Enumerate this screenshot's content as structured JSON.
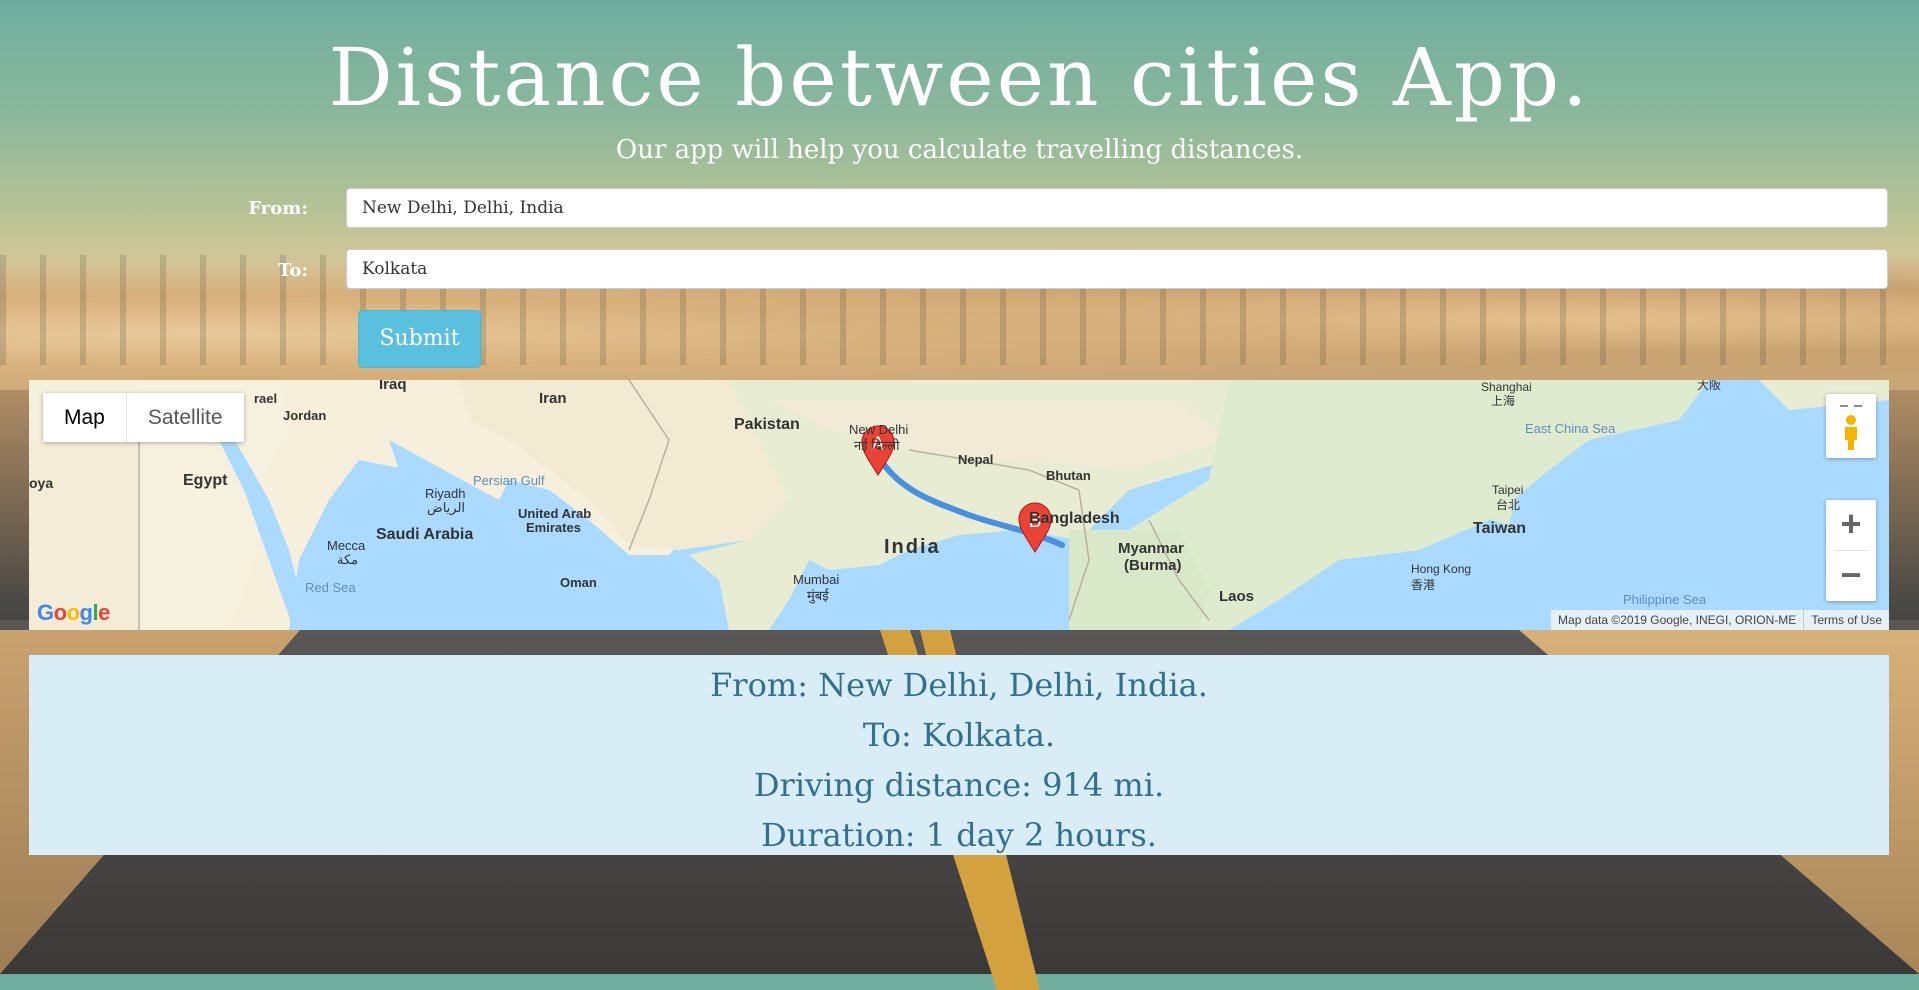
{
  "header": {
    "title": "Distance between cities App.",
    "subtitle": "Our app will help you calculate travelling distances."
  },
  "form": {
    "from_label": "From:",
    "from_value": "New Delhi, Delhi, India",
    "to_label": "To:",
    "to_value": "Kolkata",
    "submit_label": "Submit"
  },
  "map": {
    "type_controls": {
      "map": "Map",
      "satellite": "Satellite",
      "selected": "Map"
    },
    "zoom_in": "+",
    "zoom_out": "−",
    "pegman_icon": "pegman-icon",
    "markers": [
      {
        "label": "A",
        "place": "New Delhi"
      },
      {
        "label": "B",
        "place": "Kolkata"
      }
    ],
    "route_color": "#4a90e2",
    "marker_color": "#ea4335",
    "labels": {
      "iraq": "Iraq",
      "iran": "Iran",
      "pakistan": "Pakistan",
      "jordan": "Jordan",
      "israel": "rael",
      "egypt": "Egypt",
      "libya": "oya",
      "persian_gulf": "Persian Gulf",
      "riyadh": "Riyadh",
      "riyadh_ar": "الرياض",
      "saudi": "Saudi Arabia",
      "uae1": "United Arab",
      "uae2": "Emirates",
      "mecca": "Mecca",
      "mecca_ar": "مكة",
      "red_sea": "Red Sea",
      "oman": "Oman",
      "mumbai": "Mumbai",
      "mumbai_hi": "मुंबई",
      "india": "India",
      "new_delhi": "New Delhi",
      "new_delhi_hi": "नई दिल्ली",
      "nepal": "Nepal",
      "bhutan": "Bhutan",
      "bangladesh": "Bangladesh",
      "myanmar1": "Myanmar",
      "myanmar2": "(Burma)",
      "laos": "Laos",
      "shanghai": "Shanghai",
      "shanghai_cn": "上海",
      "east_china_sea": "East China Sea",
      "taipei": "Taipei",
      "taipei_cn": "台北",
      "taiwan": "Taiwan",
      "hong_kong": "Hong Kong",
      "hong_kong_cn": "香港",
      "philippine_sea": "Philippine Sea",
      "osaka": "大阪"
    },
    "logo": "Google",
    "attribution": "Map data ©2019 Google, INEGI, ORION-ME",
    "terms": "Terms of Use"
  },
  "result": {
    "from": "From: New Delhi, Delhi, India.",
    "to": "To: Kolkata.",
    "distance": "Driving distance: 914 mi.",
    "duration": "Duration: 1 day 2 hours."
  }
}
